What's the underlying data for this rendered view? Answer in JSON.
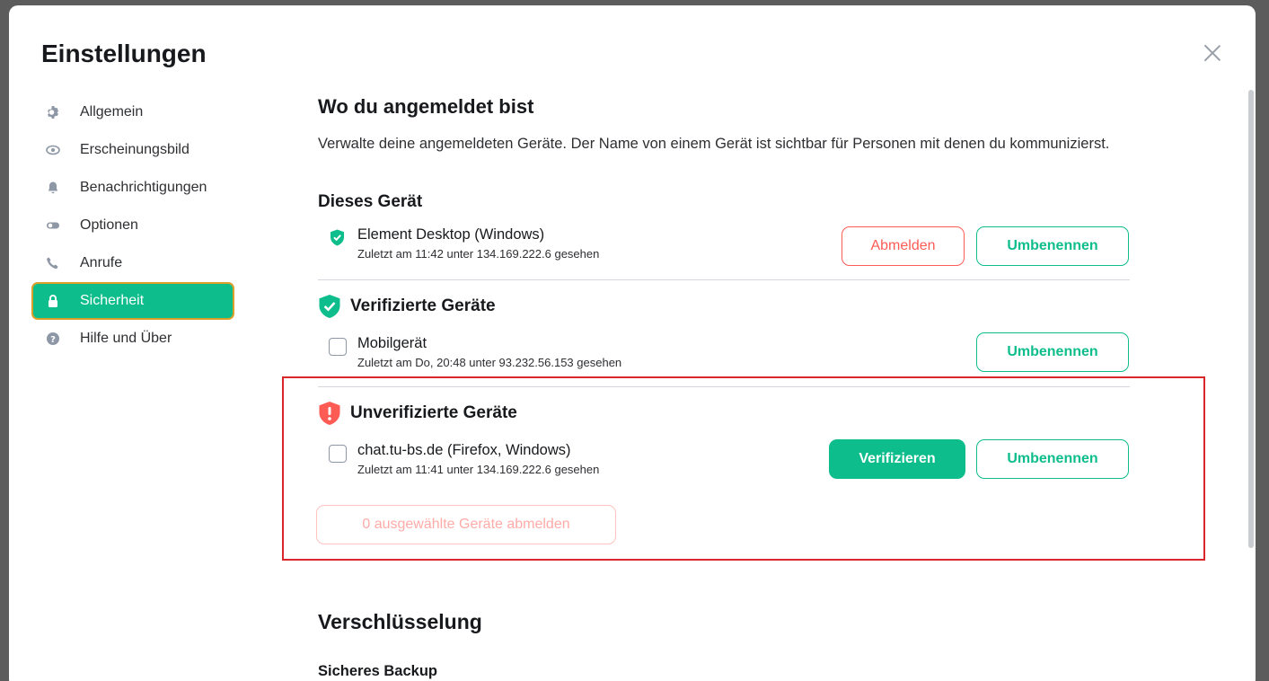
{
  "dialog": {
    "title": "Einstellungen",
    "close_icon": "close-icon"
  },
  "sidebar": {
    "items": [
      {
        "label": "Allgemein",
        "icon": "gear-icon"
      },
      {
        "label": "Erscheinungsbild",
        "icon": "eye-icon"
      },
      {
        "label": "Benachrichtigungen",
        "icon": "bell-icon"
      },
      {
        "label": "Optionen",
        "icon": "toggle-icon"
      },
      {
        "label": "Anrufe",
        "icon": "phone-icon"
      },
      {
        "label": "Sicherheit",
        "icon": "lock-icon",
        "active": true
      },
      {
        "label": "Hilfe und Über",
        "icon": "help-icon"
      }
    ]
  },
  "sessions": {
    "heading": "Wo du angemeldet bist",
    "description": "Verwalte deine angemeldeten Geräte. Der Name von einem Gerät ist sichtbar für Personen mit denen du kommunizierst.",
    "this_device": {
      "heading": "Dieses Gerät",
      "name": "Element Desktop (Windows)",
      "meta": "Zuletzt am 11:42 unter 134.169.222.6 gesehen",
      "logout_label": "Abmelden",
      "rename_label": "Umbenennen"
    },
    "verified": {
      "heading": "Verifizierte Geräte",
      "devices": [
        {
          "name": "Mobilgerät",
          "meta": "Zuletzt am Do, 20:48 unter 93.232.56.153 gesehen",
          "rename_label": "Umbenennen"
        }
      ]
    },
    "unverified": {
      "heading": "Unverifizierte Geräte",
      "devices": [
        {
          "name": "chat.tu-bs.de (Firefox, Windows)",
          "meta": "Zuletzt am 11:41 unter 134.169.222.6 gesehen",
          "verify_label": "Verifizieren",
          "rename_label": "Umbenennen"
        }
      ],
      "bulk_logout_label": "0 ausgewählte Geräte abmelden"
    }
  },
  "encryption": {
    "heading": "Verschlüsselung",
    "backup_heading": "Sicheres Backup"
  },
  "colors": {
    "accent": "#0dbd8b",
    "danger": "#ff5b55",
    "highlight": "#d9262a"
  }
}
